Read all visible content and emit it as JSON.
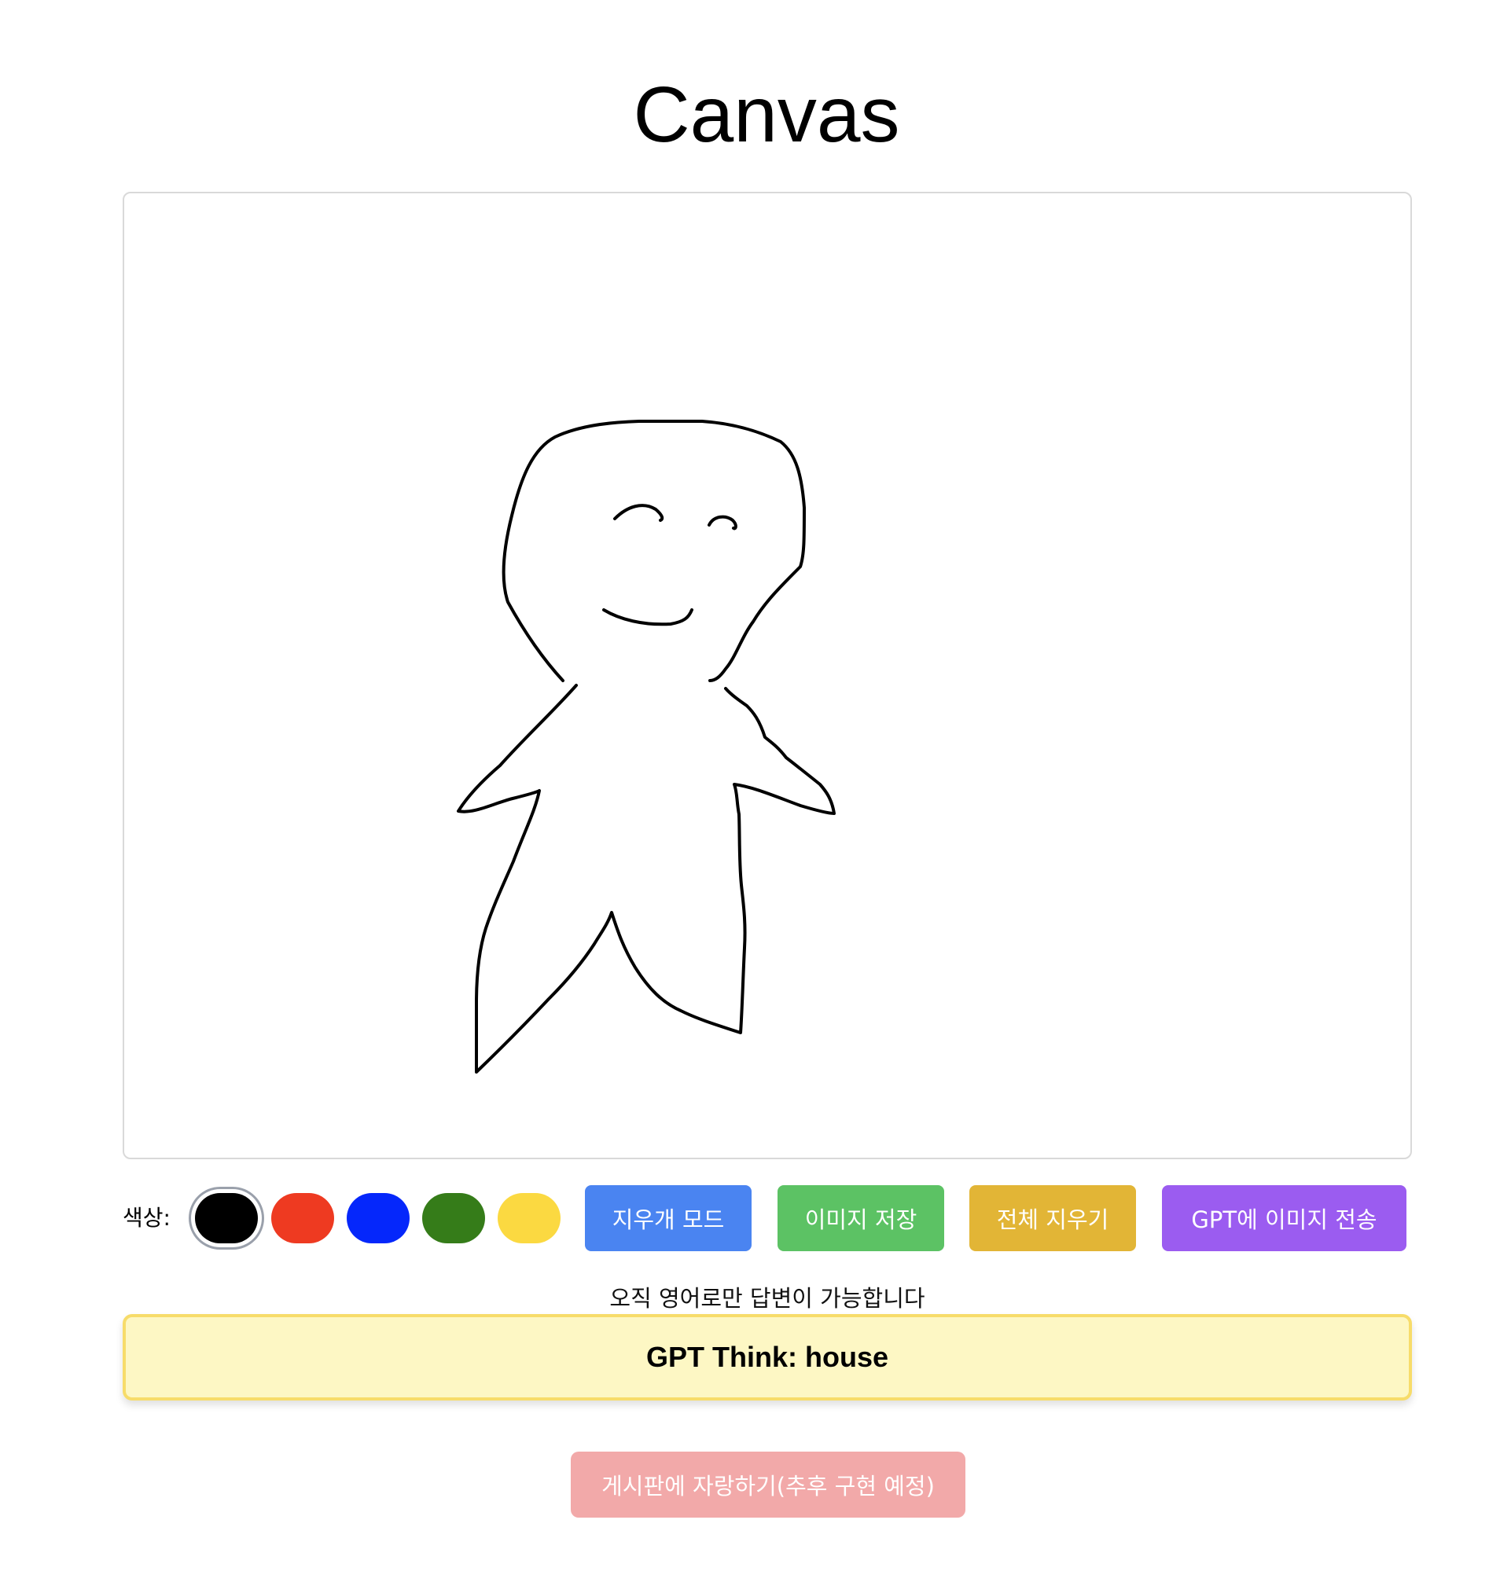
{
  "page": {
    "title": "Canvas"
  },
  "toolbar": {
    "color_label": "색상:",
    "colors": [
      {
        "name": "black",
        "hex": "#000000",
        "selected": true
      },
      {
        "name": "red",
        "hex": "#ee3a21",
        "selected": false
      },
      {
        "name": "blue",
        "hex": "#0527fb",
        "selected": false
      },
      {
        "name": "green",
        "hex": "#357c19",
        "selected": false
      },
      {
        "name": "yellow",
        "hex": "#fbd941",
        "selected": false
      }
    ],
    "eraser_label": "지우개 모드",
    "save_label": "이미지 저장",
    "clear_label": "전체 지우기",
    "send_label": "GPT에 이미지 전송"
  },
  "button_colors": {
    "eraser": "#4a84f1",
    "save": "#5cc264",
    "clear": "#e2b536",
    "send": "#9b5cf0",
    "share": "#f2a9a9"
  },
  "notice": "오직 영어로만 답변이 가능합니다",
  "result": {
    "text": "GPT Think: house"
  },
  "share": {
    "label": "게시판에 자랑하기(추후 구현 예정)"
  }
}
